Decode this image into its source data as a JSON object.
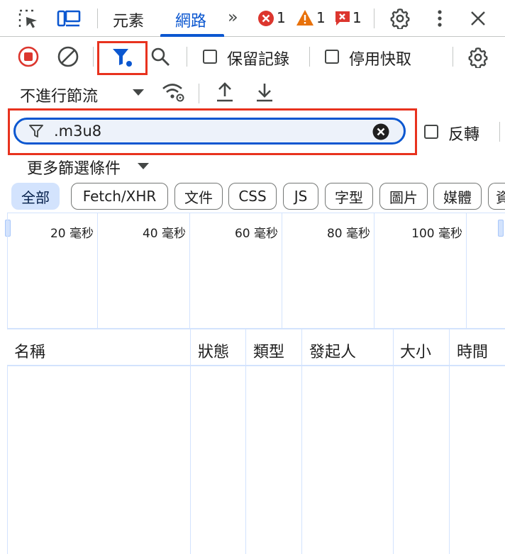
{
  "tabbar": {
    "tabs": [
      {
        "label": "元素",
        "active": false
      },
      {
        "label": "網路",
        "active": true
      }
    ],
    "more_tabs_glyph": "»",
    "errors": "1",
    "warnings": "1",
    "issues": "1",
    "icons": [
      "inspect-element-icon",
      "device-toolbar-icon",
      "more-tabs-icon",
      "error-icon",
      "warning-icon",
      "issue-icon",
      "settings-icon",
      "more-vert-icon",
      "close-icon"
    ]
  },
  "toolbar": {
    "preserve_log": "保留記錄",
    "disable_cache": "停用快取",
    "preserve_log_checked": false,
    "disable_cache_checked": false,
    "icons": [
      "record-stop-icon",
      "clear-icon",
      "filter-icon",
      "search-icon",
      "settings-icon"
    ]
  },
  "throttle": {
    "label": "不進行節流",
    "icons": [
      "dropdown-arrow-icon",
      "network-conditions-icon",
      "import-har-icon",
      "export-har-icon"
    ]
  },
  "filter": {
    "value": ".m3u8",
    "invert_label": "反轉",
    "invert_checked": false,
    "more_filters": "更多篩選條件"
  },
  "chips": [
    {
      "label": "全部",
      "active": true
    },
    {
      "label": "Fetch/XHR",
      "active": false
    },
    {
      "label": "文件",
      "active": false
    },
    {
      "label": "CSS",
      "active": false
    },
    {
      "label": "JS",
      "active": false
    },
    {
      "label": "字型",
      "active": false
    },
    {
      "label": "圖片",
      "active": false
    },
    {
      "label": "媒體",
      "active": false
    },
    {
      "label": "資",
      "active": false
    }
  ],
  "overview": {
    "ticks": [
      "20 毫秒",
      "40 毫秒",
      "60 毫秒",
      "80 毫秒",
      "100 毫秒"
    ]
  },
  "table": {
    "columns": [
      "名稱",
      "狀態",
      "類型",
      "發起人",
      "大小",
      "時間"
    ]
  },
  "colors": {
    "accent": "#0b57d0",
    "highlight": "#e8321e",
    "error": "#dc362e",
    "warning": "#e8710a",
    "chip_active": "#d3e3fd"
  }
}
